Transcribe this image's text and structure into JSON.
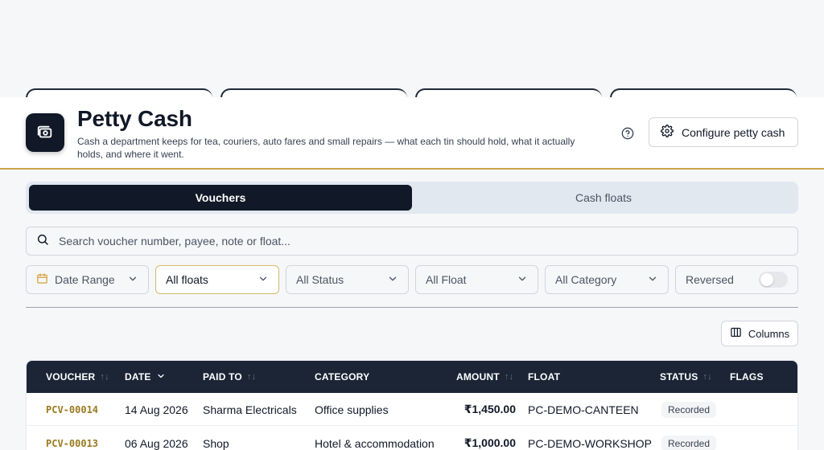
{
  "header": {
    "title": "Petty Cash",
    "description": "Cash a department keeps for tea, couriers, auto fares and small repairs — what each tin should hold, what it actually holds, and where it went.",
    "config_label": "Configure petty cash"
  },
  "tabs": [
    {
      "label": "Vouchers",
      "active": true
    },
    {
      "label": "Cash floats",
      "active": false
    }
  ],
  "search": {
    "placeholder": "Search voucher number, payee, note or float..."
  },
  "filters": {
    "date_range": "Date Range",
    "floats": "All floats",
    "status": "All Status",
    "float": "All Float",
    "category": "All Category",
    "reversed_label": "Reversed",
    "reversed_on": false
  },
  "columns_label": "Columns",
  "table": {
    "headers": {
      "voucher": "VOUCHER",
      "date": "DATE",
      "paid_to": "PAID TO",
      "category": "CATEGORY",
      "amount": "AMOUNT",
      "float": "FLOAT",
      "status": "STATUS",
      "flags": "FLAGS"
    },
    "rows": [
      {
        "voucher": "PCV-00014",
        "date": "14 Aug 2026",
        "paid_to": "Sharma Electricals",
        "category": "Office supplies",
        "amount": "₹1,450.00",
        "float": "PC-DEMO-CANTEEN",
        "status": "Recorded",
        "flags": ""
      },
      {
        "voucher": "PCV-00013",
        "date": "06 Aug 2026",
        "paid_to": "Shop",
        "category": "Hotel & accommodation",
        "amount": "₹1,000.00",
        "float": "PC-DEMO-WORKSHOP",
        "status": "Recorded",
        "flags": ""
      }
    ]
  },
  "colors": {
    "primary": "#111827",
    "accent": "#c9a54a",
    "voucher_text": "#9a7a1e"
  }
}
